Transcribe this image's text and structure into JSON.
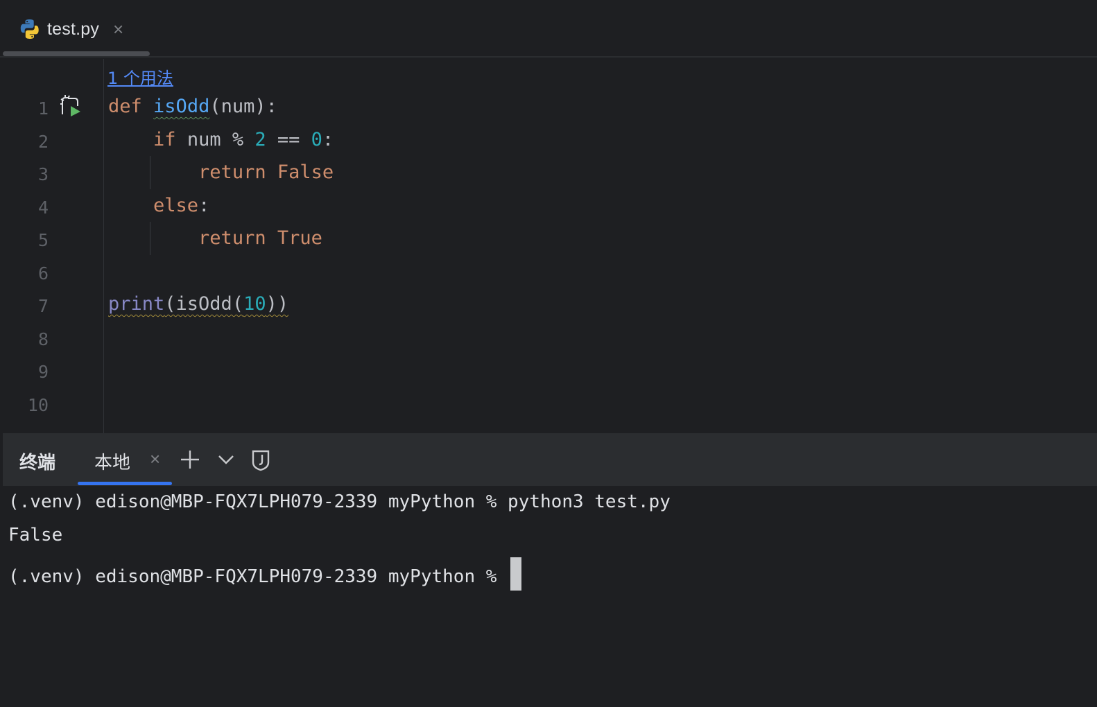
{
  "tab": {
    "label": "test.py",
    "close": "×",
    "icon": "python-file-icon"
  },
  "editor": {
    "usages_hint": "1 个用法",
    "line_numbers": [
      "1",
      "2",
      "3",
      "4",
      "5",
      "6",
      "7",
      "8",
      "9",
      "10"
    ],
    "code": {
      "l1": {
        "kw": "def",
        "fn": "isOdd",
        "rest": "(num):"
      },
      "l2": {
        "kw": "if",
        "a": "num % ",
        "n1": "2",
        "b": " == ",
        "n2": "0",
        "c": ":"
      },
      "l3": {
        "kw": "return",
        "val": "False"
      },
      "l4": {
        "kw": "else",
        "c": ":"
      },
      "l5": {
        "kw": "return",
        "val": "True"
      },
      "l7": {
        "builtin": "print",
        "a": "(isOdd(",
        "n": "10",
        "b": "))"
      }
    },
    "run_icon": "run-gutter-icon"
  },
  "terminal": {
    "title": "终端",
    "tab_label": "本地",
    "tab_close": "×",
    "buttons": [
      "new-terminal-icon",
      "dropdown-chevron-icon",
      "shield-icon"
    ],
    "lines": [
      "(.venv) edison@MBP-FQX7LPH079-2339 myPython % python3 test.py",
      "False",
      "(.venv) edison@MBP-FQX7LPH079-2339 myPython % "
    ]
  },
  "colors": {
    "background": "#1e1f22",
    "keyword": "#cf8e6d",
    "function": "#56a8f5",
    "number": "#2aacb8",
    "builtin": "#8888c6",
    "accent": "#3574f0"
  }
}
